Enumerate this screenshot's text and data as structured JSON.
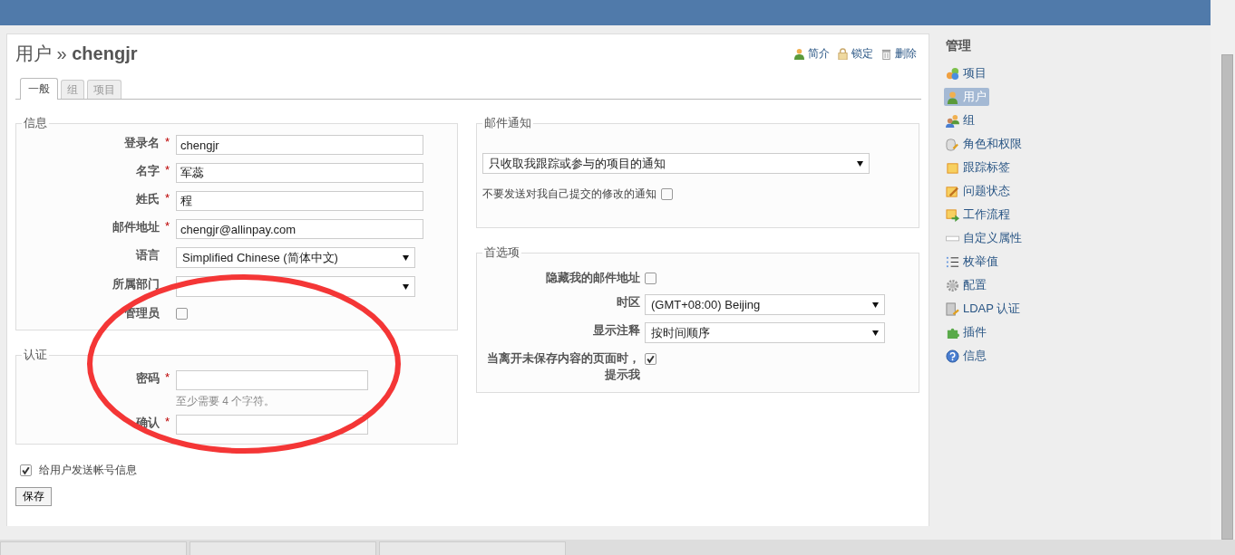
{
  "title": "用户 » **chengjr**",
  "actions": [
    {
      "label": "简介"
    },
    {
      "label": "锁定"
    },
    {
      "label": "删除"
    }
  ],
  "tabs": [
    {
      "label": "一般",
      "selected": true
    },
    {
      "label": "组",
      "selected": false
    },
    {
      "label": "项目",
      "selected": false
    }
  ],
  "info": {
    "legend": "信息",
    "fields": [
      {
        "kind": "text",
        "label": "登录名",
        "mark": "*",
        "value": "chengjr"
      },
      {
        "kind": "text",
        "label": "名字",
        "mark": "*",
        "value": "军蕊"
      },
      {
        "kind": "text",
        "label": "姓氏",
        "mark": "*",
        "value": "程"
      },
      {
        "kind": "text",
        "label": "邮件地址",
        "mark": "*",
        "value": "chengjr@allinpay.com"
      },
      {
        "kind": "select",
        "label": "语言",
        "value": "Simplified Chinese (简体中文)"
      },
      {
        "kind": "select",
        "label": "所属部门"
      },
      {
        "kind": "checkbox",
        "label": "管理员",
        "checked": false
      }
    ]
  },
  "auth": {
    "legend": "认证",
    "fields": [
      {
        "kind": "password",
        "label": "密码",
        "mark": "*",
        "hint": "至少需要 4 个字符。"
      },
      {
        "kind": "password",
        "label": "确认",
        "mark": "*"
      }
    ]
  },
  "send_info": {
    "label": "给用户发送帐号信息",
    "checked": true
  },
  "save_button": "保存",
  "mail": {
    "legend": "邮件通知",
    "select": "只收取我跟踪或参与的项目的通知",
    "option": {
      "label": "不要发送对我自己提交的修改的通知",
      "checked": false
    }
  },
  "prefs": {
    "legend": "首选项",
    "fields": [
      {
        "kind": "checkbox",
        "label": "隐藏我的邮件地址",
        "checked": false
      },
      {
        "kind": "select",
        "label": "时区",
        "value": "(GMT+08:00) Beijing"
      },
      {
        "kind": "select",
        "label": "显示注释",
        "value": "按时间顺序"
      },
      {
        "kind": "checkbox",
        "label": "当离开未保存内容的页面时，提示我",
        "checked": true
      }
    ]
  },
  "sidebar": {
    "title": "管理",
    "items": [
      {
        "label": "项目",
        "selected": false
      },
      {
        "label": "用户",
        "selected": true
      },
      {
        "label": "组",
        "selected": false
      },
      {
        "label": "角色和权限",
        "selected": false
      },
      {
        "label": "跟踪标签",
        "selected": false
      },
      {
        "label": "问题状态",
        "selected": false
      },
      {
        "label": "工作流程",
        "selected": false
      },
      {
        "label": "自定义属性",
        "selected": false
      },
      {
        "label": "枚举值",
        "selected": false
      },
      {
        "label": "配置",
        "selected": false
      },
      {
        "label": "LDAP 认证",
        "selected": false
      },
      {
        "label": "插件",
        "selected": false
      },
      {
        "label": "信息",
        "selected": false
      }
    ]
  }
}
